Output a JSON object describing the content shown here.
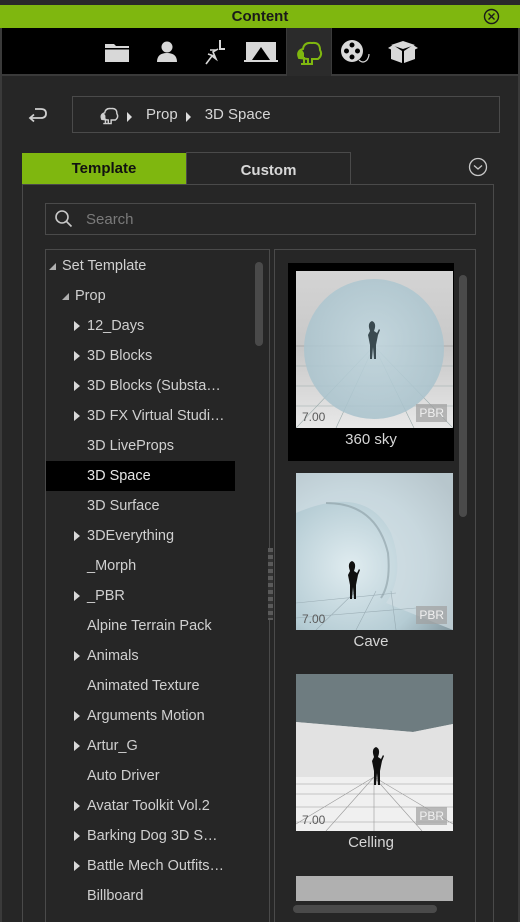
{
  "window": {
    "title": "Content",
    "close_icon": "close-circle-icon"
  },
  "category_tabs": [
    {
      "name": "project",
      "icon": "folder-icon",
      "active": false
    },
    {
      "name": "actor",
      "icon": "person-icon",
      "active": false
    },
    {
      "name": "animation",
      "icon": "running-figure-icon",
      "active": false
    },
    {
      "name": "stage",
      "icon": "stage-icon",
      "active": false
    },
    {
      "name": "set",
      "icon": "tree-set-icon",
      "active": true
    },
    {
      "name": "media",
      "icon": "film-reel-icon",
      "active": false
    },
    {
      "name": "package",
      "icon": "box-icon",
      "active": false
    }
  ],
  "colors": {
    "accent": "#7fb70f",
    "background": "#262626",
    "selection": "#000000"
  },
  "breadcrumb": {
    "root_icon": "tree-set-icon",
    "items": [
      "Prop",
      "3D Space"
    ]
  },
  "tabs": {
    "template": "Template",
    "custom": "Custom",
    "active": "Template"
  },
  "search": {
    "placeholder": "Search",
    "value": ""
  },
  "tree": {
    "items": [
      {
        "label": "Set Template",
        "level": 0,
        "state": "expanded"
      },
      {
        "label": "Prop",
        "level": 1,
        "state": "expanded"
      },
      {
        "label": "12_Days",
        "level": 2,
        "state": "collapsed"
      },
      {
        "label": "3D Blocks",
        "level": 2,
        "state": "collapsed"
      },
      {
        "label": "3D Blocks (Substa…",
        "level": 2,
        "state": "collapsed"
      },
      {
        "label": "3D FX Virtual Studi…",
        "level": 2,
        "state": "collapsed"
      },
      {
        "label": "3D LiveProps",
        "level": 2,
        "state": "leaf"
      },
      {
        "label": "3D Space",
        "level": 2,
        "state": "leaf",
        "selected": true
      },
      {
        "label": "3D Surface",
        "level": 2,
        "state": "leaf"
      },
      {
        "label": "3DEverything",
        "level": 2,
        "state": "collapsed"
      },
      {
        "label": "_Morph",
        "level": 2,
        "state": "leaf"
      },
      {
        "label": "_PBR",
        "level": 2,
        "state": "collapsed"
      },
      {
        "label": "Alpine Terrain Pack",
        "level": 2,
        "state": "leaf"
      },
      {
        "label": "Animals",
        "level": 2,
        "state": "collapsed"
      },
      {
        "label": "Animated Texture",
        "level": 2,
        "state": "leaf"
      },
      {
        "label": "Arguments Motion",
        "level": 2,
        "state": "collapsed"
      },
      {
        "label": "Artur_G",
        "level": 2,
        "state": "collapsed"
      },
      {
        "label": "Auto Driver",
        "level": 2,
        "state": "leaf"
      },
      {
        "label": "Avatar Toolkit Vol.2",
        "level": 2,
        "state": "collapsed"
      },
      {
        "label": "Barking Dog 3D S…",
        "level": 2,
        "state": "collapsed"
      },
      {
        "label": "Battle Mech Outfits…",
        "level": 2,
        "state": "collapsed"
      },
      {
        "label": "Billboard",
        "level": 2,
        "state": "leaf"
      }
    ]
  },
  "gallery": {
    "items": [
      {
        "name": "360 sky",
        "version": "7.00",
        "badge": "PBR",
        "selected": true,
        "thumb": "sphere"
      },
      {
        "name": "Cave",
        "version": "7.00",
        "badge": "PBR",
        "selected": false,
        "thumb": "cave"
      },
      {
        "name": "Celling",
        "version": "7.00",
        "badge": "PBR",
        "selected": false,
        "thumb": "ceiling"
      }
    ]
  }
}
